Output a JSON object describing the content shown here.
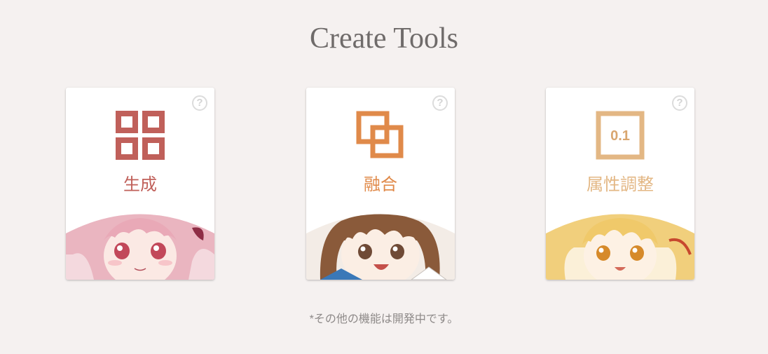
{
  "page": {
    "title": "Create Tools",
    "note": "*その他の機能は開発中です。"
  },
  "tools": [
    {
      "label": "生成",
      "icon": "grid-icon",
      "color": "#c0605a",
      "help": "?"
    },
    {
      "label": "融合",
      "icon": "overlap-squares-icon",
      "color": "#e08a4a",
      "help": "?"
    },
    {
      "label": "属性調整",
      "icon": "value-box-icon",
      "icon_text": "0.1",
      "color": "#e3b784",
      "help": "?"
    }
  ],
  "colors": {
    "background": "#f5f1f0",
    "title": "#6f6b6a",
    "help_icon": "#dcdcdc"
  }
}
